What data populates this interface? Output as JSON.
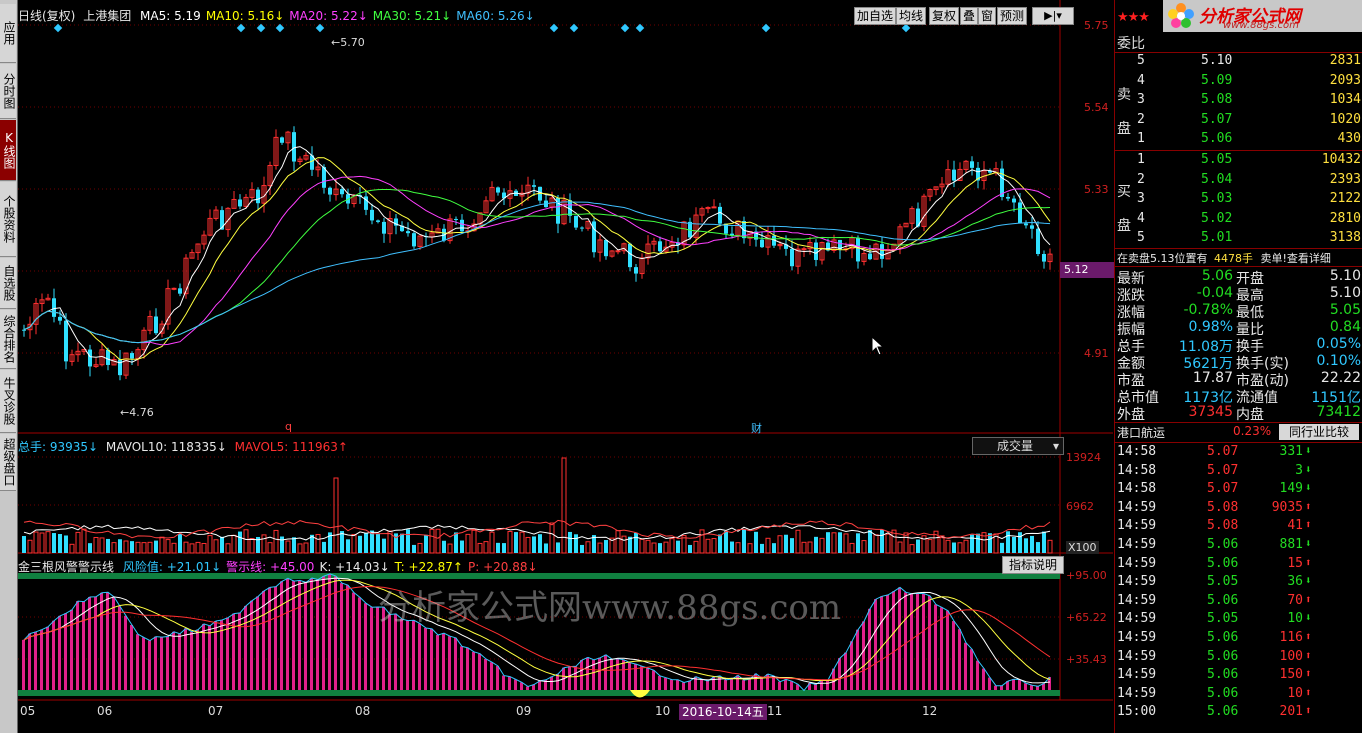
{
  "left_tabs": [
    "应用",
    "分时图",
    "K线图",
    "个股资料",
    "自选股",
    "综合排名",
    "牛叉诊股",
    "超级盘口"
  ],
  "header": {
    "title": "日线(复权)",
    "stock": "上港集团",
    "ma": [
      {
        "label": "MA5: 5.19",
        "color": "#ffffff"
      },
      {
        "label": "MA10: 5.16↓",
        "color": "#ffff00"
      },
      {
        "label": "MA20: 5.22↓",
        "color": "#ff40ff"
      },
      {
        "label": "MA30: 5.21↓",
        "color": "#40ff40"
      },
      {
        "label": "MA60: 5.26↓",
        "color": "#40c0ff"
      }
    ],
    "buttons": [
      "加自选",
      "均线",
      "复权",
      "叠",
      "窗",
      "预测"
    ]
  },
  "price_axis": [
    "5.75",
    "5.54",
    "5.33",
    "5.12",
    "4.91"
  ],
  "current_price_tag": "5.12",
  "annotations": {
    "high": "5.70",
    "low": "4.76",
    "q": "q",
    "cai": "财"
  },
  "volume": {
    "label": "总手: 93935↓",
    "mavol10": "MAVOL10: 118335↓",
    "mavol5": "MAVOL5: 111963↑",
    "dropdown": "成交量",
    "axis": [
      "13924",
      "6962"
    ],
    "unit": "X100"
  },
  "indicator": {
    "name": "金三根风警警示线",
    "vals": [
      {
        "label": "风险值: +21.01↓",
        "color": "#30c8ff"
      },
      {
        "label": "警示线: +45.00",
        "color": "#ff40ff"
      },
      {
        "label": "K: +14.03↓",
        "color": "#e8e8e8"
      },
      {
        "label": "T: +22.87↑",
        "color": "#ffff00"
      },
      {
        "label": "P: +20.88↓",
        "color": "#ff4040"
      }
    ],
    "help_button": "指标说明",
    "axis": [
      "+95.00",
      "+65.22",
      "+35.43"
    ]
  },
  "date_axis": [
    "05",
    "06",
    "07",
    "08",
    "09",
    "10",
    "11",
    "12"
  ],
  "date_cursor": "2016-10-14五",
  "watermark": "分析家公式网www.88gs.com",
  "logo": {
    "text": "分析家公式网",
    "url": "www.88gs.com"
  },
  "weibi_label": "委比",
  "sell_side_label": [
    "卖",
    "盘"
  ],
  "buy_side_label": [
    "买",
    "盘"
  ],
  "sell": [
    {
      "lvl": "5",
      "price": "5.10",
      "vol": "2831"
    },
    {
      "lvl": "4",
      "price": "5.09",
      "vol": "2093"
    },
    {
      "lvl": "3",
      "price": "5.08",
      "vol": "1034"
    },
    {
      "lvl": "2",
      "price": "5.07",
      "vol": "1020"
    },
    {
      "lvl": "1",
      "price": "5.06",
      "vol": "430"
    }
  ],
  "buy": [
    {
      "lvl": "1",
      "price": "5.05",
      "vol": "10432"
    },
    {
      "lvl": "2",
      "price": "5.04",
      "vol": "2393"
    },
    {
      "lvl": "3",
      "price": "5.03",
      "vol": "2122"
    },
    {
      "lvl": "4",
      "price": "5.02",
      "vol": "2810"
    },
    {
      "lvl": "5",
      "price": "5.01",
      "vol": "3138"
    }
  ],
  "order_notice": {
    "text": "在卖盘5.13位置有",
    "qty": "4478手",
    "link": "卖单!查看详细"
  },
  "quote": [
    {
      "l": "最新",
      "v": "5.06",
      "vc": "g",
      "l2": "开盘",
      "v2": "5.10",
      "v2c": "w"
    },
    {
      "l": "涨跌",
      "v": "-0.04",
      "vc": "g",
      "l2": "最高",
      "v2": "5.10",
      "v2c": "w"
    },
    {
      "l": "涨幅",
      "v": "-0.78%",
      "vc": "g",
      "l2": "最低",
      "v2": "5.05",
      "v2c": "g"
    },
    {
      "l": "振幅",
      "v": "0.98%",
      "vc": "c",
      "l2": "量比",
      "v2": "0.84",
      "v2c": "g"
    },
    {
      "l": "总手",
      "v": "11.08万",
      "vc": "c",
      "l2": "换手",
      "v2": "0.05%",
      "v2c": "c"
    },
    {
      "l": "金额",
      "v": "5621万",
      "vc": "c",
      "l2": "换手(实)",
      "v2": "0.10%",
      "v2c": "c"
    },
    {
      "l": "市盈",
      "v": "17.87",
      "vc": "w",
      "l2": "市盈(动)",
      "v2": "22.22",
      "v2c": "w"
    },
    {
      "l": "总市值",
      "v": "1173亿",
      "vc": "c",
      "l2": "流通值",
      "v2": "1151亿",
      "v2c": "c"
    },
    {
      "l": "外盘",
      "v": "37345",
      "vc": "r",
      "l2": "内盘",
      "v2": "73412",
      "v2c": "g"
    }
  ],
  "sector": {
    "name": "港口航运",
    "pct": "0.23%",
    "link": "同行业比较"
  },
  "ticks": [
    {
      "t": "14:58",
      "p": "5.07",
      "v": "331",
      "dir": "down"
    },
    {
      "t": "14:58",
      "p": "5.07",
      "v": "3",
      "dir": "down"
    },
    {
      "t": "14:58",
      "p": "5.07",
      "v": "149",
      "dir": "down"
    },
    {
      "t": "14:59",
      "p": "5.08",
      "v": "9035",
      "dir": "up"
    },
    {
      "t": "14:59",
      "p": "5.08",
      "v": "41",
      "dir": "up"
    },
    {
      "t": "14:59",
      "p": "5.06",
      "v": "881",
      "dir": "down"
    },
    {
      "t": "14:59",
      "p": "5.06",
      "v": "15",
      "dir": "up"
    },
    {
      "t": "14:59",
      "p": "5.05",
      "v": "36",
      "dir": "down"
    },
    {
      "t": "14:59",
      "p": "5.06",
      "v": "70",
      "dir": "up"
    },
    {
      "t": "14:59",
      "p": "5.05",
      "v": "10",
      "dir": "down"
    },
    {
      "t": "14:59",
      "p": "5.06",
      "v": "116",
      "dir": "up"
    },
    {
      "t": "14:59",
      "p": "5.06",
      "v": "100",
      "dir": "up"
    },
    {
      "t": "14:59",
      "p": "5.06",
      "v": "150",
      "dir": "up"
    },
    {
      "t": "14:59",
      "p": "5.06",
      "v": "10",
      "dir": "up"
    },
    {
      "t": "15:00",
      "p": "5.06",
      "v": "201",
      "dir": "up"
    }
  ]
}
